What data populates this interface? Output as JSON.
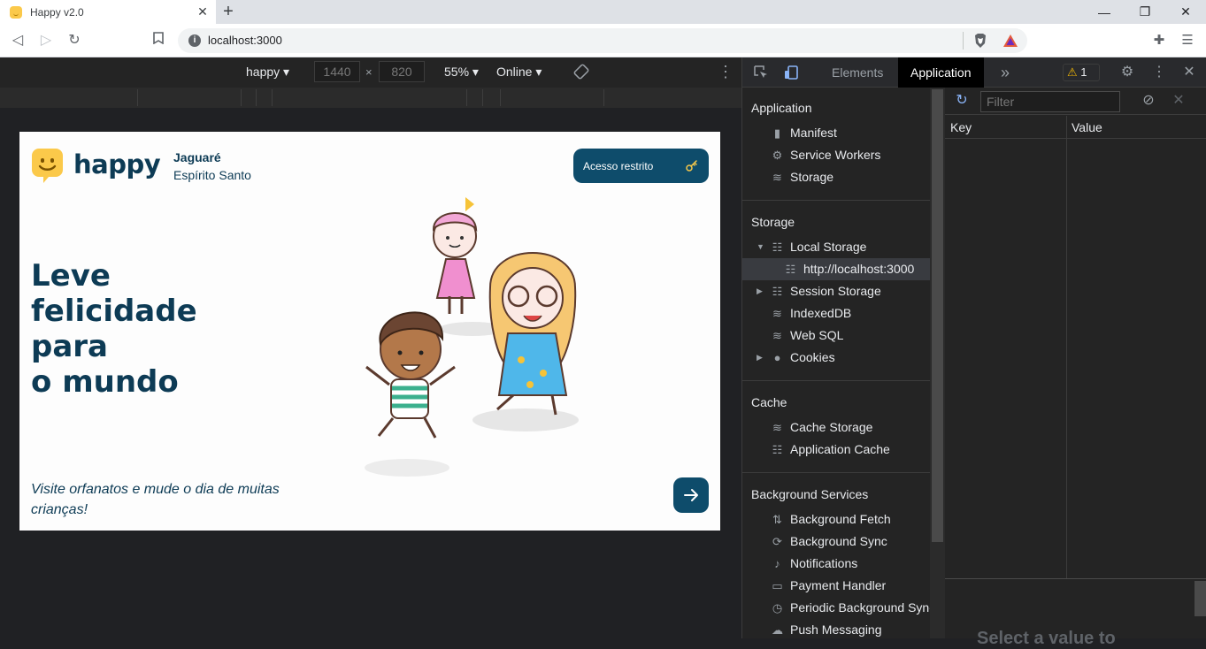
{
  "browser": {
    "tab_title": "Happy v2.0",
    "url": "localhost:3000"
  },
  "device_toolbar": {
    "device": "happy",
    "width": "1440",
    "height": "820",
    "times": "×",
    "zoom": "55%",
    "throttle": "Online"
  },
  "page": {
    "brand": "happy",
    "city": "Jaguaré",
    "state": "Espírito Santo",
    "access_label": "Acesso restrito",
    "headline": [
      "Leve",
      "felicidade",
      "para",
      "o mundo"
    ],
    "subtitle": "Visite orfanatos e mude o dia de muitas crianças!",
    "colors": {
      "brand_dark": "#0d3b55",
      "button": "#0e4c6b",
      "logo_yellow": "#fbc94a"
    }
  },
  "devtools": {
    "tabs": {
      "elements": "Elements",
      "application": "Application",
      "more": "»"
    },
    "warnings": "1",
    "sections": {
      "application": "Application",
      "storage": "Storage",
      "cache": "Cache",
      "background": "Background Services"
    },
    "app_items": [
      "Manifest",
      "Service Workers",
      "Storage"
    ],
    "storage_items": [
      "Local Storage",
      "http://localhost:3000",
      "Session Storage",
      "IndexedDB",
      "Web SQL",
      "Cookies"
    ],
    "cache_items": [
      "Cache Storage",
      "Application Cache"
    ],
    "bg_items": [
      "Background Fetch",
      "Background Sync",
      "Notifications",
      "Payment Handler",
      "Periodic Background Sync",
      "Push Messaging"
    ],
    "filter_placeholder": "Filter",
    "table": {
      "key": "Key",
      "value": "Value"
    },
    "empty_msg": "Select a value to"
  }
}
